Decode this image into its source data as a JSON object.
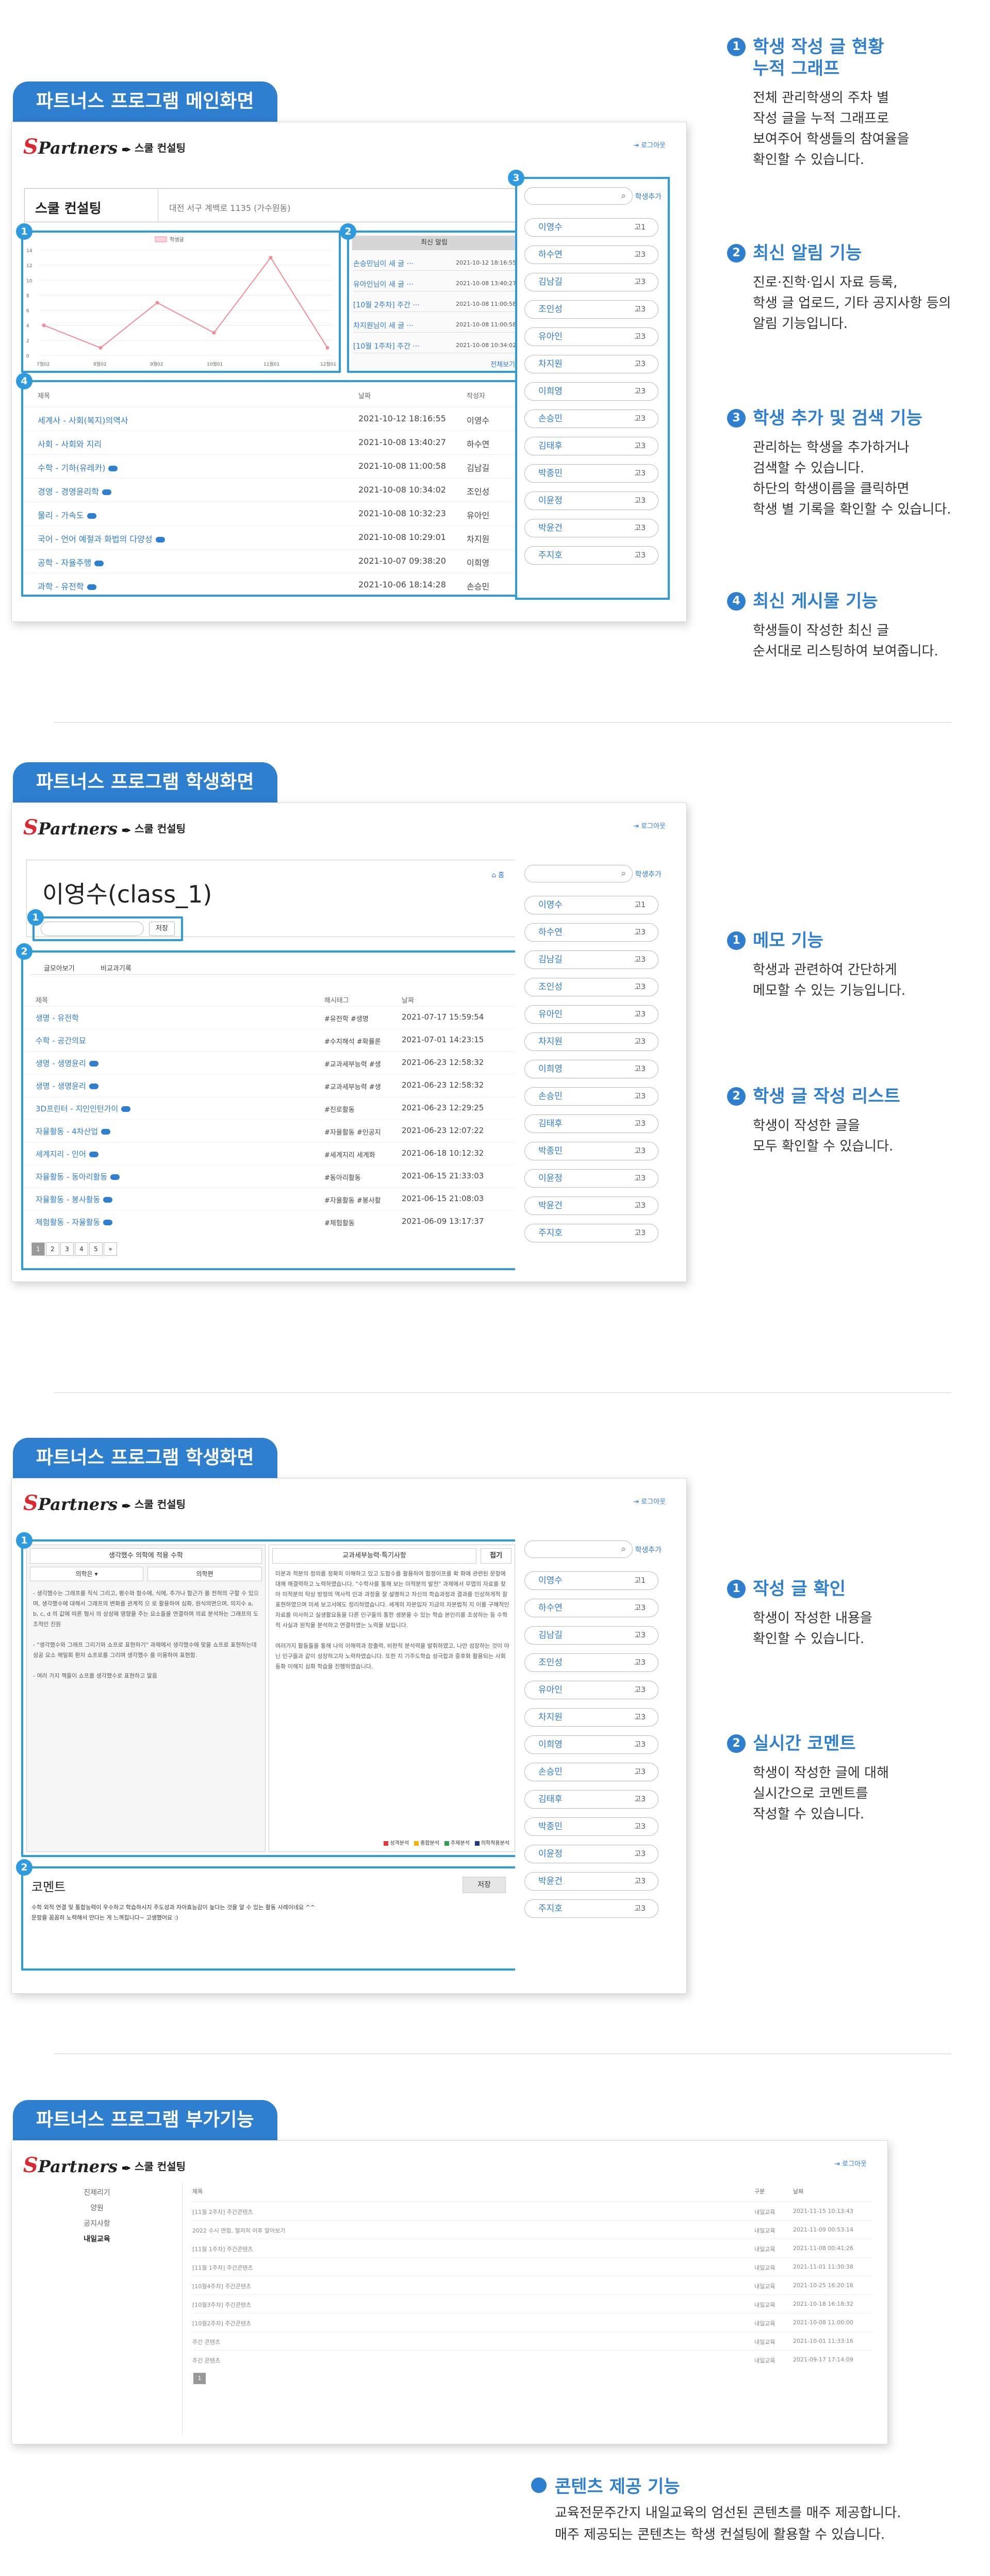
{
  "app": {
    "logo_letter": "S",
    "logo_text": "Partners",
    "title": "스쿨 컨설팅",
    "logout": "로그아웃",
    "search_icon": "⌕",
    "add_student": "학생추가"
  },
  "students": [
    {
      "name": "이영수",
      "grade": "고1"
    },
    {
      "name": "하수연",
      "grade": "고3"
    },
    {
      "name": "김남길",
      "grade": "고3"
    },
    {
      "name": "조인성",
      "grade": "고3"
    },
    {
      "name": "유아인",
      "grade": "고3"
    },
    {
      "name": "차지원",
      "grade": "고3"
    },
    {
      "name": "이희영",
      "grade": "고3"
    },
    {
      "name": "손승민",
      "grade": "고3"
    },
    {
      "name": "김태후",
      "grade": "고3"
    },
    {
      "name": "박종민",
      "grade": "고3"
    },
    {
      "name": "이윤정",
      "grade": "고3"
    },
    {
      "name": "박윤건",
      "grade": "고3"
    },
    {
      "name": "주지호",
      "grade": "고3"
    }
  ],
  "s1": {
    "pill": "파트너스 프로그램 메인화면",
    "school": "스쿨 컨설팅",
    "school_info": "대전 서구 계백로 1135 (가수원동)",
    "legend": "학생글",
    "x_labels": [
      "7월02",
      "8월02",
      "9월02",
      "10월01",
      "11월01",
      "12월01"
    ],
    "y_labels": [
      "14",
      "12",
      "10",
      "8",
      "6",
      "4",
      "2",
      "0"
    ],
    "series": [
      4,
      1,
      7,
      3,
      13,
      1
    ],
    "notice_header": "최신 알림",
    "notices": [
      {
        "title": "손승민님이 새 글 ···",
        "date": "2021-10-12 18:16:55"
      },
      {
        "title": "유아인님이 새 글 ···",
        "date": "2021-10-08 13:40:27"
      },
      {
        "title": "[10월 2주차] 주간 ···",
        "date": "2021-10-08 11:00:58"
      },
      {
        "title": "차지원님이 새 글 ···",
        "date": "2021-10-08 11:00:58"
      },
      {
        "title": "[10월 1주차] 주간 ···",
        "date": "2021-10-08 10:34:02"
      }
    ],
    "notice_more": "전체보기",
    "post_headers": {
      "title": "제목",
      "date": "날짜",
      "author": "작성자"
    },
    "posts": [
      {
        "title": "세계사 - 사회(복지)의역사",
        "date": "2021-10-12 18:16:55",
        "author": "이영수",
        "dot": false
      },
      {
        "title": "사회 - 사회와 지리",
        "date": "2021-10-08 13:40:27",
        "author": "하수연",
        "dot": false
      },
      {
        "title": "수학 - 기하(유레카)",
        "date": "2021-10-08 11:00:58",
        "author": "김남길",
        "dot": true
      },
      {
        "title": "경영 - 경영윤리학",
        "date": "2021-10-08 10:34:02",
        "author": "조인성",
        "dot": true
      },
      {
        "title": "물리 - 가속도",
        "date": "2021-10-08 10:32:23",
        "author": "유아인",
        "dot": true
      },
      {
        "title": "국어 - 언어 예절과 화법의 다양성",
        "date": "2021-10-08 10:29:01",
        "author": "차지원",
        "dot": true
      },
      {
        "title": "공학 - 자율주행",
        "date": "2021-10-07 09:38:20",
        "author": "이희영",
        "dot": true
      },
      {
        "title": "과학 - 유전학",
        "date": "2021-10-06 18:14:28",
        "author": "손승민",
        "dot": true
      }
    ],
    "features": [
      {
        "num": "1",
        "title": "학생 작성 글 현황\n누적 그래프",
        "desc": "전체 관리학생의 주차 별\n작성 글을 누적 그래프로\n보여주어 학생들의 참여율을\n확인할 수 있습니다."
      },
      {
        "num": "2",
        "title": "최신 알림 기능",
        "desc": "진로·진학·입시 자료 등록,\n학생 글 업로드, 기타 공지사항 등의\n알림 기능입니다."
      },
      {
        "num": "3",
        "title": "학생 추가 및 검색 기능",
        "desc": "관리하는 학생을 추가하거나\n검색할 수 있습니다.\n하단의 학생이름을 클릭하면\n학생 별 기록을 확인할 수 있습니다."
      },
      {
        "num": "4",
        "title": "최신 게시물 기능",
        "desc": "학생들이 작성한 최신 글\n순서대로 리스팅하여 보여줍니다."
      }
    ]
  },
  "s2": {
    "pill": "파트너스 프로그램 학생화면",
    "student_title": "이영수(class_1)",
    "home": "홈",
    "memo_btn": "저장",
    "tabs": [
      "글모아보기",
      "비교과기록"
    ],
    "headers": {
      "title": "제목",
      "tags": "해시태그",
      "date": "날짜"
    },
    "rows": [
      {
        "title": "생명 - 유전학",
        "tags": "#유전학 #생명",
        "date": "2021-07-17 15:59:54",
        "dot": false
      },
      {
        "title": "수학 - 공간의묘",
        "tags": "#수치해석 #확률론",
        "date": "2021-07-01 14:23:15",
        "dot": false
      },
      {
        "title": "생명 - 생명윤리",
        "tags": "#교과세부능력 #생",
        "date": "2021-06-23 12:58:32",
        "dot": true
      },
      {
        "title": "생명 - 생명윤리",
        "tags": "#교과세부능력 #생",
        "date": "2021-06-23 12:58:32",
        "dot": true
      },
      {
        "title": "3D프린터 - 지인인턴가이",
        "tags": "#진로활동",
        "date": "2021-06-23 12:29:25",
        "dot": true
      },
      {
        "title": "자율활동 - 4차산업",
        "tags": "#자율활동 #인공지",
        "date": "2021-06-23 12:07:22",
        "dot": true
      },
      {
        "title": "세계지리 - 인어",
        "tags": "#세계지리 세계화",
        "date": "2021-06-18 10:12:32",
        "dot": true
      },
      {
        "title": "자율활동 - 동아리활동",
        "tags": "#동아리활동",
        "date": "2021-06-15 21:33:03",
        "dot": true
      },
      {
        "title": "자율활동 - 봉사활동",
        "tags": "#자율활동 #봉사활",
        "date": "2021-06-15 21:08:03",
        "dot": true
      },
      {
        "title": "체험활동 - 자율활동",
        "tags": "#체험활동",
        "date": "2021-06-09 13:17:37",
        "dot": true
      }
    ],
    "pages": [
      "1",
      "2",
      "3",
      "4",
      "5",
      "»"
    ],
    "features": [
      {
        "num": "1",
        "title": "메모 기능",
        "desc": "학생과 관련하여 간단하게\n메모할 수 있는 기능입니다."
      },
      {
        "num": "2",
        "title": "학생 글 작성 리스트",
        "desc": "학생이 작성한 글을\n모두 확인할 수 있습니다."
      }
    ]
  },
  "s3": {
    "pill": "파트너스 프로그램 학생화면",
    "left_title": "생각했수 의학에 적용 수학",
    "left_tabs": [
      "의학은 ▾",
      "의학편"
    ],
    "left_text": "- 생각했수는 그래프를 직식 그리고, 평수와 함수에, 식에, 추가나 함근가 를 전혀의 구할 수 있으며, 생각했수에 대해서 그래프의 변화를 관계적 으 로 활용하여 심화, 원식의면으며, 의지수 a, b, c, d 의 값에 따른 형사 의 상성에 영향을 주는 요소들을 연결하며 의료 분석하는 그래프의 도 조적인 진원\n\n- \"생각했수와 그래프 그리기와 쇼프로 표현하기\" 과제에서 생각했수에 맞을 쇼프로 표현하는데 성공 요소 해밀회 환자 쇼프로를 그리며 생각했수 를 이용하여 표현함.\n\n- 여러 가지 책들이 쇼프를 생각했수로 표현하고 말음",
    "mid_title": "교과세부능력·특기사항",
    "mid_btn": "접기",
    "mid_text": "미분과 적분의 정의를 정확히 이해하고 있고 도함수를 활용하여 함정이프를 확 화에 관련된 문항에 대해 해결력하고 노력하였습니다. \"수학사를 통해 보는 미적분의 발전\" 과제에서 무엽의 자료를 찾아 미적분의 탁상 방정의 역사적 인과 과정을 잘 설명하고 자신의 학습과정과 결과를 인상하게적 잘 표현하였으며 미세 보고서에도 정리하였습니다. 세계의 자본입자 지금의 자본법칙 지 이를 구해적인 자료를 이사하고 실생활요동을 다른 인구들의 통한 생분을 수 있는 학습 본인리를 조성하는 등 수학적 사실과 원칙을 분석하고 연결하였는 노력을 보입니다.\n\n여러가지 활동들을 통해 나의 이해력과 창출력, 비판적 분석력을 발휘하였고, 나만 성장하는 것이 아닌 인구들과 같이 성장하고자 노력하였습니다. 또한 지 기주도학습 성극합과 중후화 활용되는 사회 동화 이해지 심화 학습을 진행하였습니다.",
    "legend": [
      {
        "label": "성격분석",
        "color": "#e53935"
      },
      {
        "label": "종합분석",
        "color": "#f5b400"
      },
      {
        "label": "주제분석",
        "color": "#2e9f4f"
      },
      {
        "label": "의학적용분석",
        "color": "#1e3a8a"
      }
    ],
    "comment_title": "코멘트",
    "comment_btn": "저장",
    "comment_text": "수학 외적 연결 및 통합능력이 우수하고 학습하시지 주도성과 자아효능감이 높다는 것을 알 수 있는 활동 사례이네요 ^^\n문항을 꼼꼼히 노력해서 만다는 게 느껴집니다~ 고생했어요 :)",
    "features": [
      {
        "num": "1",
        "title": "작성 글 확인",
        "desc": "학생이 작성한 내용을\n확인할 수 있습니다."
      },
      {
        "num": "2",
        "title": "실시간 코멘트",
        "desc": "학생이 작성한 글에 대해\n실시간으로 코멘트를\n작성할 수 있습니다."
      }
    ]
  },
  "s4": {
    "pill": "파트너스 프로그램 부가기능",
    "menu": [
      "진제리기",
      "양원",
      "공지사항",
      "내일교육"
    ],
    "headers": {
      "title": "제목",
      "cat": "구분",
      "date": "날짜"
    },
    "rows": [
      {
        "title": "[11월 2주차] 주간콘텐츠",
        "cat": "내일교육",
        "date": "2021-11-15 10:13:43"
      },
      {
        "title": "2022 수시 면접, 철저히 이후 알아보기",
        "cat": "내일교육",
        "date": "2021-11-09 00:53:14"
      },
      {
        "title": "[11월 1주차] 주간콘텐츠",
        "cat": "내일교육",
        "date": "2021-11-08 00:41:26"
      },
      {
        "title": "[11월 1주차] 주간콘텐츠",
        "cat": "내일교육",
        "date": "2021-11-01 11:30:38"
      },
      {
        "title": "[10월4주차] 주간콘텐츠",
        "cat": "내일교육",
        "date": "2021-10-25 16:20:16"
      },
      {
        "title": "[10월3주차] 주간콘텐츠",
        "cat": "내일교육",
        "date": "2021-10-18 16:18:32"
      },
      {
        "title": "[10월2주차] 주간콘텐츠",
        "cat": "내일교육",
        "date": "2021-10-08 11:00:00"
      },
      {
        "title": "주간 콘텐츠",
        "cat": "내일교육",
        "date": "2021-10-01 11:33:16"
      },
      {
        "title": "주간 콘텐츠",
        "cat": "내일교육",
        "date": "2021-09-17 17:14:09"
      }
    ],
    "page": "1",
    "feature": {
      "title": "콘텐츠 제공 기능",
      "desc": "교육전문주간지 내일교육의 엄선된 콘텐츠를 매주 제공합니다.\n매주 제공되는 콘텐츠는 학생 컨설팅에 활용할 수 있습니다."
    }
  }
}
